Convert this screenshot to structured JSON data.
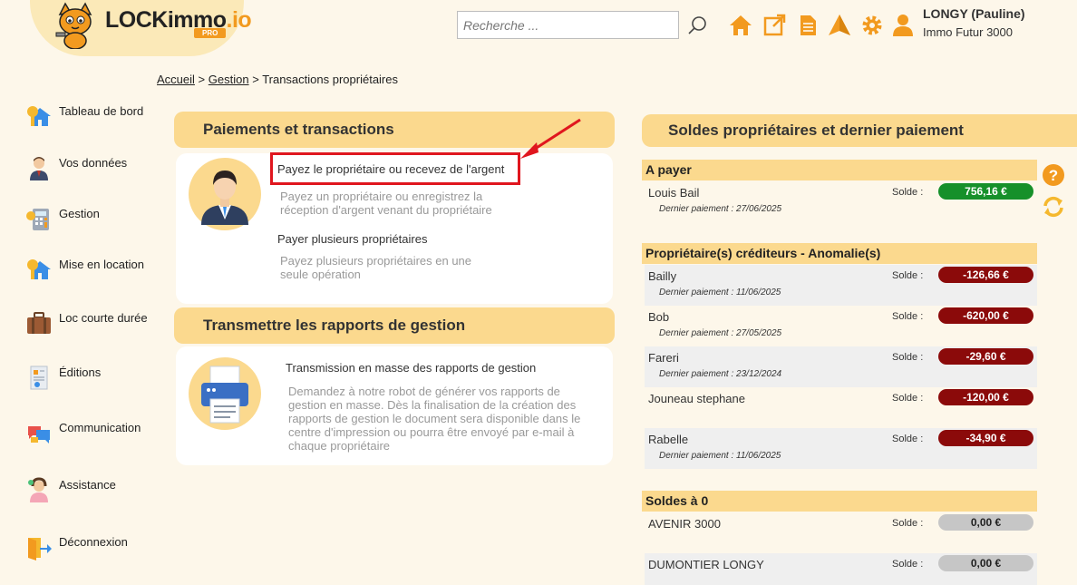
{
  "header": {
    "logo_text": "LOCKimmo",
    "logo_suffix": ".io",
    "logo_badge": "PRO",
    "search_placeholder": "Recherche ...",
    "user_name": "LONGY (Pauline)",
    "user_agency": "Immo Futur 3000",
    "icons": [
      "search-icon",
      "home-icon",
      "external-link-icon",
      "document-icon",
      "alert-icon",
      "gear-icon",
      "user-icon"
    ],
    "accent_color": "#f29a1f"
  },
  "breadcrumb": {
    "home": "Accueil",
    "section": "Gestion",
    "current": "Transactions propriétaires"
  },
  "sidebar": {
    "items": [
      {
        "label": "Tableau de bord",
        "icon": "dashboard-house-key-icon"
      },
      {
        "label": "Vos données",
        "icon": "person-icon"
      },
      {
        "label": "Gestion",
        "icon": "calculator-icon"
      },
      {
        "label": "Mise en location",
        "icon": "house-key-icon"
      },
      {
        "label": "Loc courte durée",
        "icon": "suitcase-icon"
      },
      {
        "label": "Éditions",
        "icon": "report-icon"
      },
      {
        "label": "Communication",
        "icon": "chat-bubbles-icon"
      },
      {
        "label": "Assistance",
        "icon": "support-agent-icon"
      },
      {
        "label": "Déconnexion",
        "icon": "logout-icon"
      }
    ]
  },
  "payments": {
    "title": "Paiements et transactions",
    "action1_title": "Payez le propriétaire ou recevez de l'argent",
    "action1_desc": "Payez un propriétaire ou enregistrez la réception d'argent venant du propriétaire",
    "action2_title": "Payer plusieurs propriétaires",
    "action2_desc": "Payez plusieurs propriétaires en une seule opération"
  },
  "reports": {
    "title": "Transmettre les rapports de gestion",
    "action_title": "Transmission en masse des rapports de gestion",
    "action_desc": "Demandez à notre robot de générer vos rapports de gestion en masse. Dès la finalisation de la création des rapports de gestion le document sera disponible dans le centre d'impression ou pourra être envoyé par e-mail à chaque propriétaire"
  },
  "balances": {
    "title": "Soldes propriétaires et dernier paiement",
    "solde_label": "Solde :",
    "sections": [
      {
        "title": "A payer",
        "rows": [
          {
            "name": "Louis Bail",
            "date": "Dernier paiement : 27/06/2025",
            "amount": "756,16 €",
            "status": "positive"
          }
        ]
      },
      {
        "title": "Propriétaire(s) créditeurs - Anomalie(s)",
        "rows": [
          {
            "name": "Bailly",
            "date": "Dernier paiement : 11/06/2025",
            "amount": "-126,66 €",
            "status": "negative"
          },
          {
            "name": "Bob",
            "date": "Dernier paiement : 27/05/2025",
            "amount": "-620,00 €",
            "status": "negative"
          },
          {
            "name": "Fareri",
            "date": "Dernier paiement : 23/12/2024",
            "amount": "-29,60 €",
            "status": "negative"
          },
          {
            "name": "Jouneau stephane",
            "date": "",
            "amount": "-120,00 €",
            "status": "negative"
          },
          {
            "name": "Rabelle",
            "date": "Dernier paiement : 11/06/2025",
            "amount": "-34,90 €",
            "status": "negative"
          }
        ]
      },
      {
        "title": "Soldes à 0",
        "rows": [
          {
            "name": "AVENIR 3000",
            "date": "",
            "amount": "0,00 €",
            "status": "zero"
          },
          {
            "name": "DUMONTIER LONGY",
            "date": "",
            "amount": "0,00 €",
            "status": "zero"
          }
        ]
      }
    ],
    "colors": {
      "positive": "#16902a",
      "negative": "#8b0a0a",
      "zero": "#c6c6c6"
    }
  }
}
